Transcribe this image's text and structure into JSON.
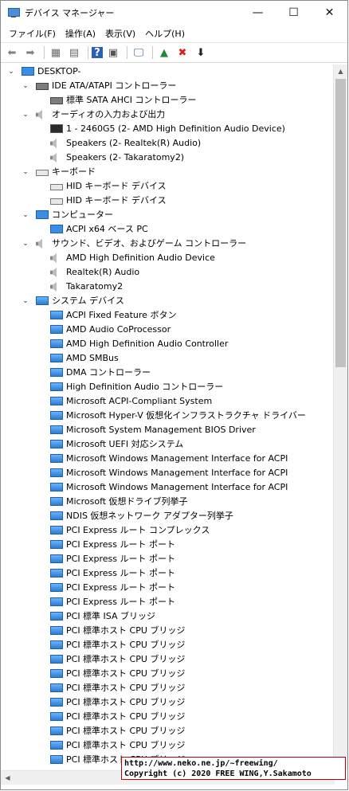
{
  "window": {
    "title": "デバイス マネージャー",
    "minimize": "—",
    "maximize": "☐",
    "close": "✕"
  },
  "menu": [
    "ファイル(F)",
    "操作(A)",
    "表示(V)",
    "ヘルプ(H)"
  ],
  "toolbar": {
    "icons": [
      "back-arrow-icon",
      "forward-arrow-icon",
      "properties-list-icon",
      "view-icon",
      "help-icon",
      "driver-update-icon",
      "monitor-scan-icon",
      "enable-device-icon",
      "uninstall-icon",
      "download-icon"
    ],
    "glyphs": [
      "⬅",
      "➡",
      "▦",
      "▤",
      "?",
      "▣",
      "🖵",
      "▲",
      "✖",
      "⬇"
    ],
    "colors": [
      "#808080",
      "#808080",
      "#6a6a6a",
      "#6a6a6a",
      "#2a5fb7",
      "#555555",
      "#2b5e9b",
      "#1d8a34",
      "#e01b1b",
      "#222222"
    ]
  },
  "tree": {
    "root": {
      "label": "DESKTOP-",
      "icon": "computer"
    },
    "rows": [
      {
        "level": 1,
        "expander": "v",
        "icon": "disk",
        "label": "IDE ATA/ATAPI コントローラー"
      },
      {
        "level": 2,
        "expander": "",
        "icon": "disk",
        "label": "標準 SATA AHCI コントローラー"
      },
      {
        "level": 1,
        "expander": "v",
        "icon": "speaker",
        "label": "オーディオの入力および出力"
      },
      {
        "level": 2,
        "expander": "",
        "icon": "monitor",
        "label": "1 - 2460G5 (2- AMD High Definition Audio Device)"
      },
      {
        "level": 2,
        "expander": "",
        "icon": "speaker",
        "label": "Speakers (2- Realtek(R) Audio)"
      },
      {
        "level": 2,
        "expander": "",
        "icon": "speaker",
        "label": "Speakers (2- Takaratomy2)"
      },
      {
        "level": 1,
        "expander": "v",
        "icon": "keyboard",
        "label": "キーボード"
      },
      {
        "level": 2,
        "expander": "",
        "icon": "keyboard",
        "label": "HID キーボード デバイス"
      },
      {
        "level": 2,
        "expander": "",
        "icon": "keyboard",
        "label": "HID キーボード デバイス"
      },
      {
        "level": 1,
        "expander": "v",
        "icon": "computer",
        "label": "コンピューター"
      },
      {
        "level": 2,
        "expander": "",
        "icon": "computer",
        "label": "ACPI x64 ベース PC"
      },
      {
        "level": 1,
        "expander": "v",
        "icon": "speaker",
        "label": "サウンド、ビデオ、およびゲーム コントローラー"
      },
      {
        "level": 2,
        "expander": "",
        "icon": "speaker",
        "label": "AMD High Definition Audio Device"
      },
      {
        "level": 2,
        "expander": "",
        "icon": "speaker",
        "label": "Realtek(R) Audio"
      },
      {
        "level": 2,
        "expander": "",
        "icon": "speaker",
        "label": "Takaratomy2"
      },
      {
        "level": 1,
        "expander": "v",
        "icon": "sysdev",
        "label": "システム デバイス"
      },
      {
        "level": 2,
        "expander": "",
        "icon": "sysdev",
        "label": "ACPI Fixed Feature ボタン"
      },
      {
        "level": 2,
        "expander": "",
        "icon": "sysdev",
        "label": "AMD Audio CoProcessor"
      },
      {
        "level": 2,
        "expander": "",
        "icon": "sysdev",
        "label": "AMD High Definition Audio Controller"
      },
      {
        "level": 2,
        "expander": "",
        "icon": "sysdev",
        "label": "AMD SMBus"
      },
      {
        "level": 2,
        "expander": "",
        "icon": "sysdev",
        "label": "DMA コントローラー"
      },
      {
        "level": 2,
        "expander": "",
        "icon": "sysdev",
        "label": "High Definition Audio コントローラー"
      },
      {
        "level": 2,
        "expander": "",
        "icon": "sysdev",
        "label": "Microsoft ACPI-Compliant System"
      },
      {
        "level": 2,
        "expander": "",
        "icon": "sysdev",
        "label": "Microsoft Hyper-V 仮想化インフラストラクチャ ドライバー"
      },
      {
        "level": 2,
        "expander": "",
        "icon": "sysdev",
        "label": "Microsoft System Management BIOS Driver"
      },
      {
        "level": 2,
        "expander": "",
        "icon": "sysdev",
        "label": "Microsoft UEFI 対応システム"
      },
      {
        "level": 2,
        "expander": "",
        "icon": "sysdev",
        "label": "Microsoft Windows Management Interface for ACPI"
      },
      {
        "level": 2,
        "expander": "",
        "icon": "sysdev",
        "label": "Microsoft Windows Management Interface for ACPI"
      },
      {
        "level": 2,
        "expander": "",
        "icon": "sysdev",
        "label": "Microsoft Windows Management Interface for ACPI"
      },
      {
        "level": 2,
        "expander": "",
        "icon": "sysdev",
        "label": "Microsoft 仮想ドライブ列挙子"
      },
      {
        "level": 2,
        "expander": "",
        "icon": "sysdev",
        "label": "NDIS 仮想ネットワーク アダプター列挙子"
      },
      {
        "level": 2,
        "expander": "",
        "icon": "sysdev",
        "label": "PCI Express ルート コンプレックス"
      },
      {
        "level": 2,
        "expander": "",
        "icon": "sysdev",
        "label": "PCI Express ルート ポート"
      },
      {
        "level": 2,
        "expander": "",
        "icon": "sysdev",
        "label": "PCI Express ルート ポート"
      },
      {
        "level": 2,
        "expander": "",
        "icon": "sysdev",
        "label": "PCI Express ルート ポート"
      },
      {
        "level": 2,
        "expander": "",
        "icon": "sysdev",
        "label": "PCI Express ルート ポート"
      },
      {
        "level": 2,
        "expander": "",
        "icon": "sysdev",
        "label": "PCI Express ルート ポート"
      },
      {
        "level": 2,
        "expander": "",
        "icon": "sysdev",
        "label": "PCI 標準 ISA ブリッジ"
      },
      {
        "level": 2,
        "expander": "",
        "icon": "sysdev",
        "label": "PCI 標準ホスト CPU ブリッジ"
      },
      {
        "level": 2,
        "expander": "",
        "icon": "sysdev",
        "label": "PCI 標準ホスト CPU ブリッジ"
      },
      {
        "level": 2,
        "expander": "",
        "icon": "sysdev",
        "label": "PCI 標準ホスト CPU ブリッジ"
      },
      {
        "level": 2,
        "expander": "",
        "icon": "sysdev",
        "label": "PCI 標準ホスト CPU ブリッジ"
      },
      {
        "level": 2,
        "expander": "",
        "icon": "sysdev",
        "label": "PCI 標準ホスト CPU ブリッジ"
      },
      {
        "level": 2,
        "expander": "",
        "icon": "sysdev",
        "label": "PCI 標準ホスト CPU ブリッジ"
      },
      {
        "level": 2,
        "expander": "",
        "icon": "sysdev",
        "label": "PCI 標準ホスト CPU ブリッジ"
      },
      {
        "level": 2,
        "expander": "",
        "icon": "sysdev",
        "label": "PCI 標準ホスト CPU ブリッジ"
      },
      {
        "level": 2,
        "expander": "",
        "icon": "sysdev",
        "label": "PCI 標準ホスト CPU ブリッジ"
      },
      {
        "level": 2,
        "expander": "",
        "icon": "sysdev",
        "label": "PCI 標準ホスト CPU ブリッジ"
      }
    ]
  },
  "watermark": {
    "line1": "http://www.neko.ne.jp/~freewing/",
    "line2": "Copyright (c) 2020 FREE WING,Y.Sakamoto"
  }
}
